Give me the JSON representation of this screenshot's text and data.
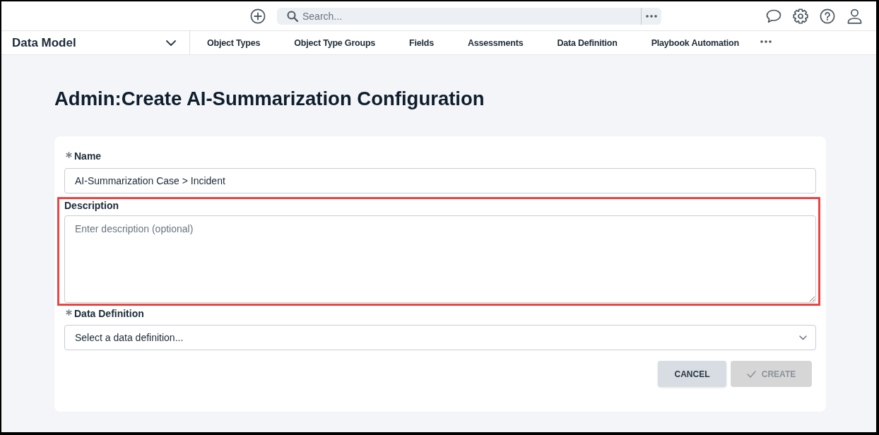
{
  "top_bar": {
    "search": {
      "placeholder": "Search..."
    }
  },
  "nav": {
    "module": "Data Model",
    "tabs": [
      {
        "label": "Object Types"
      },
      {
        "label": "Object Type Groups"
      },
      {
        "label": "Fields"
      },
      {
        "label": "Assessments"
      },
      {
        "label": "Data Definition"
      },
      {
        "label": "Playbook Automation"
      }
    ]
  },
  "page": {
    "title": "Admin:Create AI-Summarization Configuration"
  },
  "form": {
    "fields": [
      {
        "kind": "text",
        "label": "Name",
        "required": true,
        "highlighted": false,
        "value": "AI-Summarization Case > Incident"
      },
      {
        "kind": "textarea",
        "label": "Description",
        "required": false,
        "highlighted": true,
        "placeholder": "Enter description (optional)"
      },
      {
        "kind": "select",
        "label": "Data Definition",
        "required": true,
        "highlighted": false,
        "placeholder": "Select a data definition..."
      }
    ],
    "buttons": [
      {
        "kind": "plain",
        "label": "CANCEL",
        "disabled": false
      },
      {
        "kind": "confirm",
        "label": "CREATE",
        "disabled": true
      }
    ]
  }
}
